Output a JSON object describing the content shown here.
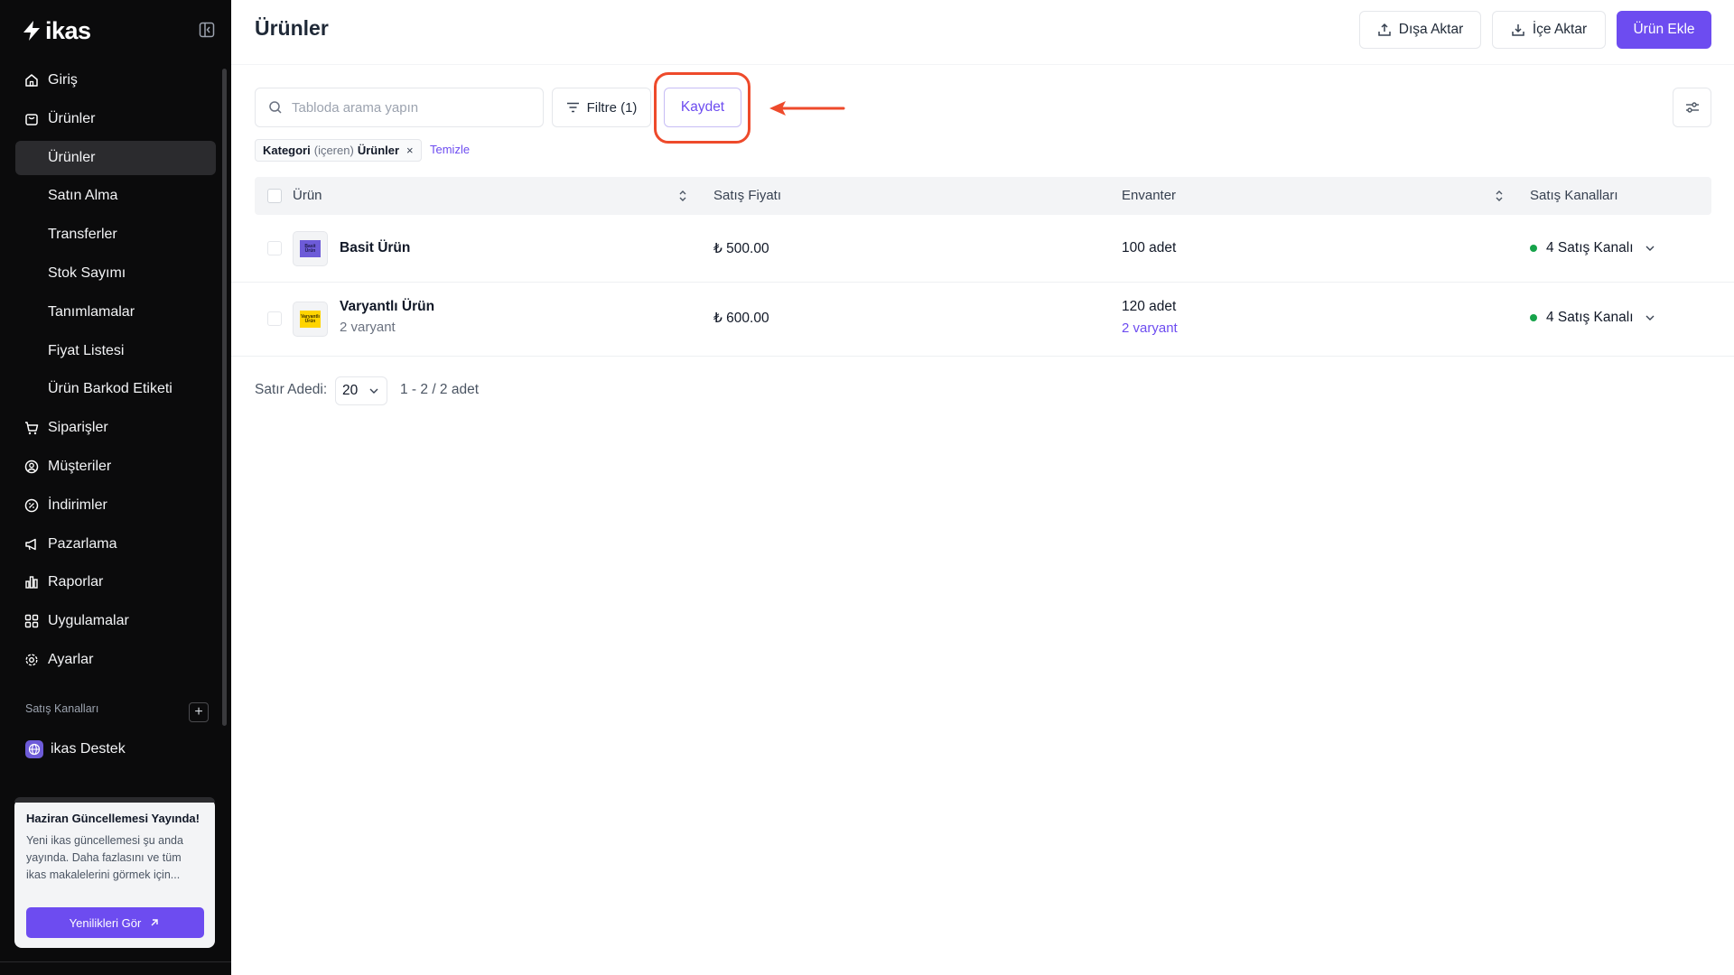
{
  "brand": {
    "name": "ikas",
    "accent": "#6d4cf0",
    "annotation": "#ee4a2b"
  },
  "sidebar": {
    "items": [
      {
        "label": "Giriş",
        "icon": "home-icon"
      },
      {
        "label": "Ürünler",
        "icon": "product-tag-icon"
      },
      {
        "label": "Ürünler",
        "sub": true,
        "active": true
      },
      {
        "label": "Satın Alma",
        "sub": true
      },
      {
        "label": "Transferler",
        "sub": true
      },
      {
        "label": "Stok Sayımı",
        "sub": true
      },
      {
        "label": "Tanımlamalar",
        "sub": true
      },
      {
        "label": "Fiyat Listesi",
        "sub": true
      },
      {
        "label": "Ürün Barkod Etiketi",
        "sub": true
      },
      {
        "label": "Siparişler",
        "icon": "cart-icon"
      },
      {
        "label": "Müşteriler",
        "icon": "user-circle-icon"
      },
      {
        "label": "İndirimler",
        "icon": "discount-icon"
      },
      {
        "label": "Pazarlama",
        "icon": "megaphone-icon"
      },
      {
        "label": "Raporlar",
        "icon": "bar-chart-icon"
      },
      {
        "label": "Uygulamalar",
        "icon": "apps-grid-icon"
      },
      {
        "label": "Ayarlar",
        "icon": "gear-icon"
      }
    ],
    "sales_channels_title": "Satış Kanalları",
    "store_label": "ikas Destek",
    "promo": {
      "title": "Haziran Güncellemesi Yayında!",
      "text": "Yeni ikas güncellemesi şu anda yayında. Daha fazlasını ve tüm ikas makalelerini görmek için...",
      "button": "Yenilikleri Gör"
    }
  },
  "header": {
    "title": "Ürünler",
    "export_label": "Dışa Aktar",
    "import_label": "İçe Aktar",
    "add_label": "Ürün Ekle"
  },
  "toolbar": {
    "search_placeholder": "Tabloda arama yapın",
    "filter_label": "Filtre (1)",
    "save_label": "Kaydet"
  },
  "filter_chip": {
    "field": "Kategori",
    "operator": "(içeren)",
    "value": "Ürünler",
    "remove": "×",
    "clear_label": "Temizle"
  },
  "table": {
    "columns": [
      "Ürün",
      "Satış Fiyatı",
      "Envanter",
      "Satış Kanalları"
    ],
    "rows": [
      {
        "name": "Basit Ürün",
        "thumb_text": "Basit Ürün",
        "thumb_bg": "#6d5bd8",
        "price": "₺ 500.00",
        "inventory": "100 adet",
        "channels": "4 Satış Kanalı"
      },
      {
        "name": "Varyantlı Ürün",
        "sub": "2 varyant",
        "thumb_text": "Varyantlı Ürün",
        "thumb_bg": "#ffd400",
        "price": "₺ 600.00",
        "inventory": "120 adet",
        "inventory_link": "2 varyant",
        "channels": "4 Satış Kanalı"
      }
    ]
  },
  "pagination": {
    "label": "Satır Adedi:",
    "page_size": "20",
    "range": "1 - 2 / 2 adet"
  }
}
